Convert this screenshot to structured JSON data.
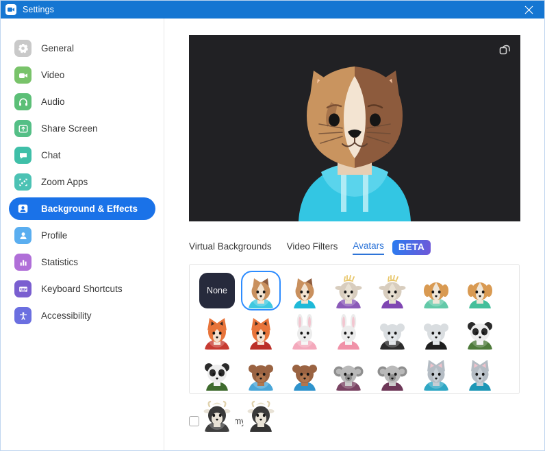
{
  "window": {
    "title": "Settings",
    "app_icon": "zoom-camera-icon",
    "close_label": "Close",
    "titlebar_color": "#1576d2"
  },
  "sidebar": {
    "items": [
      {
        "label": "General",
        "icon": "gear-icon",
        "color": "#c9c9c9",
        "active": false
      },
      {
        "label": "Video",
        "icon": "video-camera-icon",
        "color": "#79c36a",
        "active": false
      },
      {
        "label": "Audio",
        "icon": "headphones-icon",
        "color": "#5cbf77",
        "active": false
      },
      {
        "label": "Share Screen",
        "icon": "share-screen-icon",
        "color": "#54bf86",
        "active": false
      },
      {
        "label": "Chat",
        "icon": "chat-bubble-icon",
        "color": "#3fbfa8",
        "active": false
      },
      {
        "label": "Zoom Apps",
        "icon": "zoom-apps-icon",
        "color": "#4cc2b4",
        "active": false
      },
      {
        "label": "Background & Effects",
        "icon": "person-frame-icon",
        "color": "#1a72e8",
        "active": true
      },
      {
        "label": "Profile",
        "icon": "person-icon",
        "color": "#5aaef0",
        "active": false
      },
      {
        "label": "Statistics",
        "icon": "bar-chart-icon",
        "color": "#b06fd8",
        "active": false
      },
      {
        "label": "Keyboard Shortcuts",
        "icon": "keyboard-icon",
        "color": "#7a5fd0",
        "active": false
      },
      {
        "label": "Accessibility",
        "icon": "accessibility-icon",
        "color": "#6b6fe0",
        "active": false
      }
    ]
  },
  "preview": {
    "popout_icon": "popout-window-icon",
    "background_color": "#212124",
    "current_avatar": "cat-cyan-hoodie"
  },
  "tabs": [
    {
      "label": "Virtual Backgrounds",
      "active": false
    },
    {
      "label": "Video Filters",
      "active": false
    },
    {
      "label": "Avatars",
      "active": true
    }
  ],
  "beta_badge": {
    "label": "BETA",
    "gradient_from": "#2a7cf0",
    "gradient_to": "#6f57d8"
  },
  "avatar_grid": {
    "none_label": "None",
    "selected_index": 1,
    "items": [
      {
        "name": "None",
        "type": "none"
      },
      {
        "name": "Cat hoodie",
        "type": "cat",
        "fur": "#c9905e",
        "fur2": "#8d5b3d",
        "face": "#f3e4d2",
        "body": "#3fc8e0",
        "hood": true
      },
      {
        "name": "Cat shirt",
        "type": "cat",
        "fur": "#c9905e",
        "fur2": "#8d5b3d",
        "face": "#f3e4d2",
        "body": "#1fb9d8",
        "hood": false
      },
      {
        "name": "Horse hoodie",
        "type": "horse",
        "fur": "#d8cdbe",
        "fur2": "#b9ab97",
        "face": "#e8e0d2",
        "body": "#8a5ab8",
        "hood": true
      },
      {
        "name": "Horse shirt",
        "type": "horse",
        "fur": "#d8cdbe",
        "fur2": "#b9ab97",
        "face": "#e8e0d2",
        "body": "#7f46b2",
        "hood": false
      },
      {
        "name": "Dog hoodie",
        "type": "dog",
        "fur": "#d99a52",
        "fur2": "#efe6d8",
        "face": "#efe6d8",
        "body": "#63c9a8",
        "hood": true
      },
      {
        "name": "Dog shirt",
        "type": "dog",
        "fur": "#d99a52",
        "fur2": "#efe6d8",
        "face": "#efe6d8",
        "body": "#44bf9b",
        "hood": false
      },
      {
        "name": "Fox hoodie",
        "type": "fox",
        "fur": "#e8743a",
        "fur2": "#f3e0d0",
        "face": "#f6e8dc",
        "body": "#c73b32",
        "hood": true
      },
      {
        "name": "Fox shirt",
        "type": "fox",
        "fur": "#e8743a",
        "fur2": "#f3e0d0",
        "face": "#f6e8dc",
        "body": "#bb2f28",
        "hood": false
      },
      {
        "name": "Rabbit hoodie",
        "type": "rabbit",
        "fur": "#ececec",
        "fur2": "#f2c6d0",
        "face": "#f7f7f7",
        "body": "#f4a9bc",
        "hood": true
      },
      {
        "name": "Rabbit shirt",
        "type": "rabbit",
        "fur": "#ececec",
        "fur2": "#f2c6d0",
        "face": "#f7f7f7",
        "body": "#f092a8",
        "hood": false
      },
      {
        "name": "Polar bear hoodie",
        "type": "bearw",
        "fur": "#d9dde0",
        "fur2": "#c2c8cd",
        "face": "#e3e7ea",
        "body": "#2c2c2c",
        "hood": true
      },
      {
        "name": "Polar bear shirt",
        "type": "bearw",
        "fur": "#d9dde0",
        "fur2": "#c2c8cd",
        "face": "#e3e7ea",
        "body": "#1f1f1f",
        "hood": false
      },
      {
        "name": "Panda hoodie",
        "type": "panda",
        "fur": "#ededed",
        "fur2": "#2b2b2b",
        "face": "#f3f3f3",
        "body": "#4d7a3a",
        "hood": true
      },
      {
        "name": "Panda shirt",
        "type": "panda",
        "fur": "#ededed",
        "fur2": "#2b2b2b",
        "face": "#f3f3f3",
        "body": "#3f6b2e",
        "hood": false
      },
      {
        "name": "Bear hoodie",
        "type": "bear",
        "fur": "#9a6342",
        "fur2": "#7d4e33",
        "face": "#b0764f",
        "body": "#4aa6d8",
        "hood": true
      },
      {
        "name": "Bear shirt",
        "type": "bear",
        "fur": "#9a6342",
        "fur2": "#7d4e33",
        "face": "#b0764f",
        "body": "#2f93cc",
        "hood": false
      },
      {
        "name": "Koala hoodie",
        "type": "koala",
        "fur": "#b9b9b9",
        "fur2": "#8f8f8f",
        "face": "#cccccc",
        "body": "#7a4463",
        "hood": true
      },
      {
        "name": "Koala shirt",
        "type": "koala",
        "fur": "#b9b9b9",
        "fur2": "#8f8f8f",
        "face": "#cccccc",
        "body": "#6e3858",
        "hood": false
      },
      {
        "name": "Gray cat hoodie",
        "type": "gcat",
        "fur": "#b4bcc4",
        "fur2": "#8d969e",
        "face": "#c7ced5",
        "body": "#2fa7c4",
        "hood": true
      },
      {
        "name": "Gray cat shirt",
        "type": "gcat",
        "fur": "#b4bcc4",
        "fur2": "#8d969e",
        "face": "#c7ced5",
        "body": "#1e97b6",
        "hood": false
      },
      {
        "name": "Cow hoodie",
        "type": "cow",
        "fur": "#3a3a3a",
        "fur2": "#e8e2d6",
        "face": "#e8e2d6",
        "body": "#3f3f3f",
        "hood": true
      },
      {
        "name": "Cow shirt",
        "type": "cow",
        "fur": "#3a3a3a",
        "fur2": "#e8e2d6",
        "face": "#e8e2d6",
        "body": "#333333",
        "hood": false
      }
    ]
  },
  "mirror": {
    "label": "Mirror my video",
    "checked": false
  }
}
